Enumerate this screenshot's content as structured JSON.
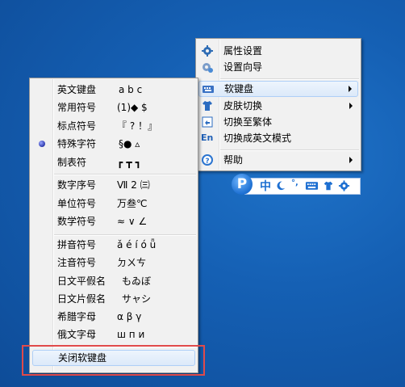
{
  "right_menu": {
    "items": [
      {
        "label": "属性设置",
        "icon": "gear-icon"
      },
      {
        "label": "设置向导",
        "icon": "wizard-gear-icon"
      },
      {
        "label": "软键盘",
        "icon": "keyboard-icon",
        "submenu": true
      },
      {
        "label": "皮肤切换",
        "icon": "shirt-icon",
        "submenu": true
      },
      {
        "label": "切换至繁体",
        "icon": "convert-icon"
      },
      {
        "label": "切换成英文模式",
        "icon": "en-icon"
      },
      {
        "label": "帮助",
        "icon": "help-icon",
        "submenu": true
      }
    ],
    "en_icon_text": "En"
  },
  "keyboard_menu": {
    "items": [
      {
        "label": "英文键盘",
        "sample": "a b c"
      },
      {
        "label": "常用符号",
        "sample": "(1)◆ $"
      },
      {
        "label": "标点符号",
        "sample": "『 ? ！』"
      },
      {
        "label": "特殊字符",
        "sample": "§● ▵",
        "checked": true
      },
      {
        "label": "制表符",
        "sample": "┏ ┳ ┓"
      },
      {
        "label": "数字序号",
        "sample": "Ⅶ 2 ㈢"
      },
      {
        "label": "单位符号",
        "sample": "万叁℃"
      },
      {
        "label": "数学符号",
        "sample": "≈ ∨ ∠"
      },
      {
        "label": "拼音符号",
        "sample": "ǎ é í ó ǖ"
      },
      {
        "label": "注音符号",
        "sample": "ㄉㄨㄘ"
      },
      {
        "label": "日文平假名",
        "sample": "もゐぼ"
      },
      {
        "label": "日文片假名",
        "sample": "サャシ"
      },
      {
        "label": "希腊字母",
        "sample": "α β γ"
      },
      {
        "label": "俄文字母",
        "sample": "ш п и"
      },
      {
        "label": "关闭软键盘"
      }
    ]
  },
  "toolbar": {
    "logo_letter": "P",
    "mode_label": "中",
    "punct_label": "°,"
  },
  "colors": {
    "highlight_border": "#e04a4a",
    "toolbar_blue": "#1d6fd1"
  }
}
